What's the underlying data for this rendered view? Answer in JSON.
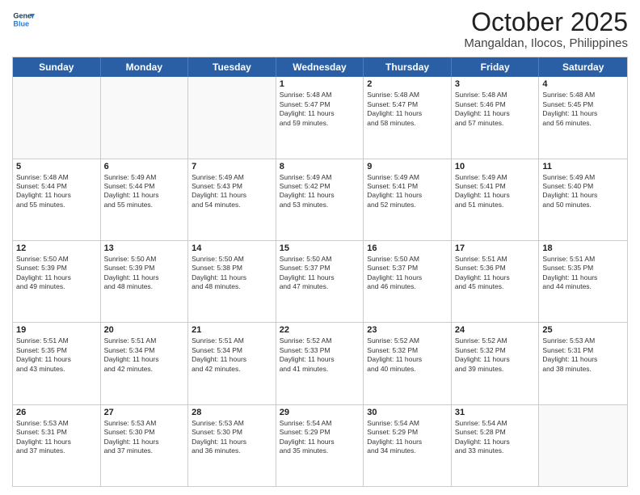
{
  "logo": {
    "line1": "General",
    "line2": "Blue"
  },
  "header": {
    "month": "October 2025",
    "location": "Mangaldan, Ilocos, Philippines"
  },
  "weekdays": [
    "Sunday",
    "Monday",
    "Tuesday",
    "Wednesday",
    "Thursday",
    "Friday",
    "Saturday"
  ],
  "weeks": [
    [
      {
        "day": "",
        "info": ""
      },
      {
        "day": "",
        "info": ""
      },
      {
        "day": "",
        "info": ""
      },
      {
        "day": "1",
        "info": "Sunrise: 5:48 AM\nSunset: 5:47 PM\nDaylight: 11 hours\nand 59 minutes."
      },
      {
        "day": "2",
        "info": "Sunrise: 5:48 AM\nSunset: 5:47 PM\nDaylight: 11 hours\nand 58 minutes."
      },
      {
        "day": "3",
        "info": "Sunrise: 5:48 AM\nSunset: 5:46 PM\nDaylight: 11 hours\nand 57 minutes."
      },
      {
        "day": "4",
        "info": "Sunrise: 5:48 AM\nSunset: 5:45 PM\nDaylight: 11 hours\nand 56 minutes."
      }
    ],
    [
      {
        "day": "5",
        "info": "Sunrise: 5:48 AM\nSunset: 5:44 PM\nDaylight: 11 hours\nand 55 minutes."
      },
      {
        "day": "6",
        "info": "Sunrise: 5:49 AM\nSunset: 5:44 PM\nDaylight: 11 hours\nand 55 minutes."
      },
      {
        "day": "7",
        "info": "Sunrise: 5:49 AM\nSunset: 5:43 PM\nDaylight: 11 hours\nand 54 minutes."
      },
      {
        "day": "8",
        "info": "Sunrise: 5:49 AM\nSunset: 5:42 PM\nDaylight: 11 hours\nand 53 minutes."
      },
      {
        "day": "9",
        "info": "Sunrise: 5:49 AM\nSunset: 5:41 PM\nDaylight: 11 hours\nand 52 minutes."
      },
      {
        "day": "10",
        "info": "Sunrise: 5:49 AM\nSunset: 5:41 PM\nDaylight: 11 hours\nand 51 minutes."
      },
      {
        "day": "11",
        "info": "Sunrise: 5:49 AM\nSunset: 5:40 PM\nDaylight: 11 hours\nand 50 minutes."
      }
    ],
    [
      {
        "day": "12",
        "info": "Sunrise: 5:50 AM\nSunset: 5:39 PM\nDaylight: 11 hours\nand 49 minutes."
      },
      {
        "day": "13",
        "info": "Sunrise: 5:50 AM\nSunset: 5:39 PM\nDaylight: 11 hours\nand 48 minutes."
      },
      {
        "day": "14",
        "info": "Sunrise: 5:50 AM\nSunset: 5:38 PM\nDaylight: 11 hours\nand 48 minutes."
      },
      {
        "day": "15",
        "info": "Sunrise: 5:50 AM\nSunset: 5:37 PM\nDaylight: 11 hours\nand 47 minutes."
      },
      {
        "day": "16",
        "info": "Sunrise: 5:50 AM\nSunset: 5:37 PM\nDaylight: 11 hours\nand 46 minutes."
      },
      {
        "day": "17",
        "info": "Sunrise: 5:51 AM\nSunset: 5:36 PM\nDaylight: 11 hours\nand 45 minutes."
      },
      {
        "day": "18",
        "info": "Sunrise: 5:51 AM\nSunset: 5:35 PM\nDaylight: 11 hours\nand 44 minutes."
      }
    ],
    [
      {
        "day": "19",
        "info": "Sunrise: 5:51 AM\nSunset: 5:35 PM\nDaylight: 11 hours\nand 43 minutes."
      },
      {
        "day": "20",
        "info": "Sunrise: 5:51 AM\nSunset: 5:34 PM\nDaylight: 11 hours\nand 42 minutes."
      },
      {
        "day": "21",
        "info": "Sunrise: 5:51 AM\nSunset: 5:34 PM\nDaylight: 11 hours\nand 42 minutes."
      },
      {
        "day": "22",
        "info": "Sunrise: 5:52 AM\nSunset: 5:33 PM\nDaylight: 11 hours\nand 41 minutes."
      },
      {
        "day": "23",
        "info": "Sunrise: 5:52 AM\nSunset: 5:32 PM\nDaylight: 11 hours\nand 40 minutes."
      },
      {
        "day": "24",
        "info": "Sunrise: 5:52 AM\nSunset: 5:32 PM\nDaylight: 11 hours\nand 39 minutes."
      },
      {
        "day": "25",
        "info": "Sunrise: 5:53 AM\nSunset: 5:31 PM\nDaylight: 11 hours\nand 38 minutes."
      }
    ],
    [
      {
        "day": "26",
        "info": "Sunrise: 5:53 AM\nSunset: 5:31 PM\nDaylight: 11 hours\nand 37 minutes."
      },
      {
        "day": "27",
        "info": "Sunrise: 5:53 AM\nSunset: 5:30 PM\nDaylight: 11 hours\nand 37 minutes."
      },
      {
        "day": "28",
        "info": "Sunrise: 5:53 AM\nSunset: 5:30 PM\nDaylight: 11 hours\nand 36 minutes."
      },
      {
        "day": "29",
        "info": "Sunrise: 5:54 AM\nSunset: 5:29 PM\nDaylight: 11 hours\nand 35 minutes."
      },
      {
        "day": "30",
        "info": "Sunrise: 5:54 AM\nSunset: 5:29 PM\nDaylight: 11 hours\nand 34 minutes."
      },
      {
        "day": "31",
        "info": "Sunrise: 5:54 AM\nSunset: 5:28 PM\nDaylight: 11 hours\nand 33 minutes."
      },
      {
        "day": "",
        "info": ""
      }
    ]
  ]
}
